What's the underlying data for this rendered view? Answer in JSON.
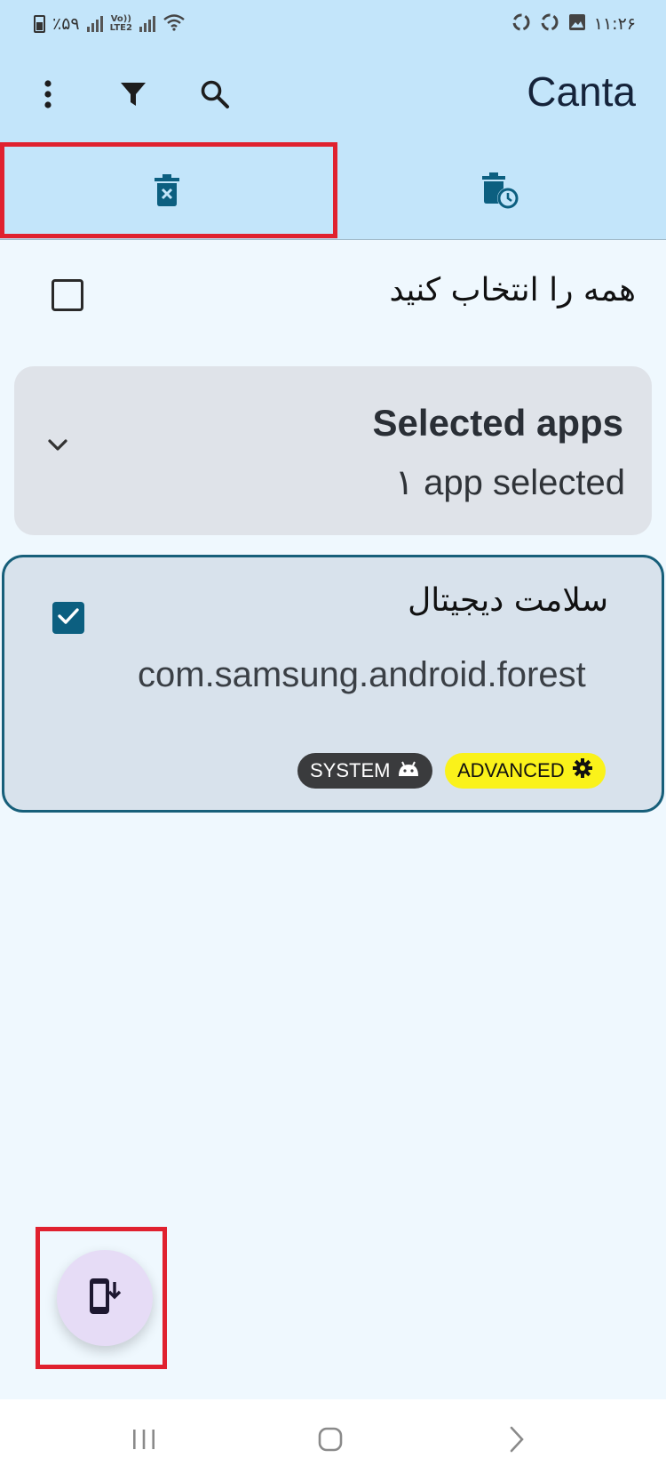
{
  "status_bar": {
    "battery_text": "٪۵۹",
    "network_label_top": "Vo))",
    "network_label_bottom": "LTE2",
    "time": "۱۱:۲۶"
  },
  "app_bar": {
    "title": "Canta",
    "actions": [
      {
        "name": "more-options",
        "icon": "more-vert-icon"
      },
      {
        "name": "filter",
        "icon": "filter-icon"
      },
      {
        "name": "search",
        "icon": "search-icon"
      }
    ]
  },
  "tabs": [
    {
      "name": "uninstall",
      "icon": "delete-x-icon",
      "selected": true
    },
    {
      "name": "history",
      "icon": "delete-clock-icon",
      "selected": false
    }
  ],
  "select_all": {
    "label": "همه را انتخاب کنید",
    "checked": false
  },
  "selected_apps": {
    "title": "Selected apps",
    "subtitle": "۱ app selected",
    "expand_icon": "chevron-down-icon"
  },
  "app_list": [
    {
      "name": "سلامت دیجیتال",
      "package": "com.samsung.android.forest",
      "checked": true,
      "badges": [
        {
          "label": "SYSTEM",
          "icon": "android-icon"
        },
        {
          "label": "ADVANCED",
          "icon": "gear-icon"
        }
      ]
    }
  ],
  "fab": {
    "icon": "phone-download-icon"
  },
  "colors": {
    "top_bar": "#c3e5fa",
    "page": "#eff8fe",
    "accent": "#0c5f80",
    "highlight": "#e0212f",
    "advanced_badge": "#faf21a",
    "system_badge": "#3a3b3d"
  }
}
